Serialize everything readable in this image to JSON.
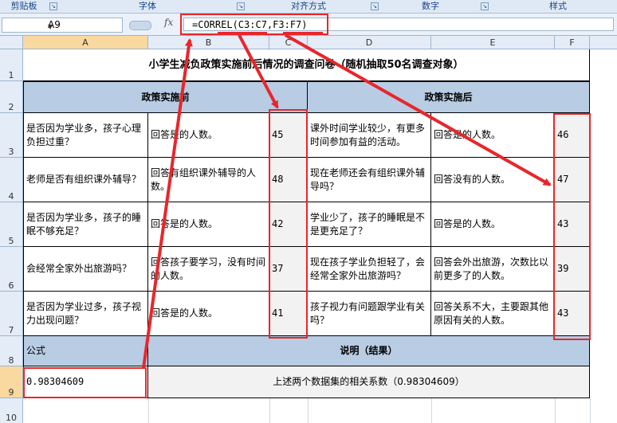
{
  "ribbon": {
    "groups": [
      "剪贴板",
      "字体",
      "对齐方式",
      "数字",
      "样式"
    ]
  },
  "formula_bar": {
    "name_box": "A9",
    "fx_label": "fx",
    "formula": "=CORREL(C3:C7,F3:F7)"
  },
  "columns": [
    "A",
    "B",
    "C",
    "D",
    "E",
    "F"
  ],
  "rows": [
    "1",
    "2",
    "3",
    "4",
    "5",
    "6",
    "7",
    "8",
    "9",
    "10"
  ],
  "sheet": {
    "title": "小学生减负政策实施前后情况的调查问卷（随机抽取50名调查对象）",
    "before_header": "政策实施前",
    "after_header": "政策实施后",
    "rows": [
      {
        "q_before": "是否因为学业多，孩子心理负担过重？",
        "a_before": "回答是的人数。",
        "v_before": "45",
        "q_after": "课外时间学业较少，有更多时间参加有益的活动。",
        "a_after": "回答是的人数。",
        "v_after": "46"
      },
      {
        "q_before": "老师是否有组织课外辅导？",
        "a_before": "回答有组织课外辅导的人数。",
        "v_before": "48",
        "q_after": "现在老师还会有组织课外辅导吗？",
        "a_after": "回答没有的人数。",
        "v_after": "47"
      },
      {
        "q_before": "是否因为学业多，孩子的睡眠不够充足？",
        "a_before": "回答是的人数。",
        "v_before": "42",
        "q_after": "学业少了，孩子的睡眠是不是更充足了？",
        "a_after": "回答是的人数。",
        "v_after": "43"
      },
      {
        "q_before": "会经常全家外出旅游吗？",
        "a_before": "回答孩子要学习，没有时间的人数。",
        "v_before": "37",
        "q_after": "现在孩子学业负担轻了，会经常全家外出旅游吗？",
        "a_after": "回答会外出旅游，次数比以前更多了的人数。",
        "v_after": "39"
      },
      {
        "q_before": "是否因为学业过多，孩子视力出现问题？",
        "a_before": "回答是的人数。",
        "v_before": "41",
        "q_after": "孩子视力有问题跟学业有关吗？",
        "a_after": "回答关系不大，主要跟其他原因有关的人数。",
        "v_after": "43"
      }
    ],
    "formula_header": "公式",
    "explain_header": "说明（结果）",
    "formula_result": "0.98304609",
    "explain_result": "上述两个数据集的相关系数（0.98304609）"
  },
  "annotation_color": "#e8262b"
}
